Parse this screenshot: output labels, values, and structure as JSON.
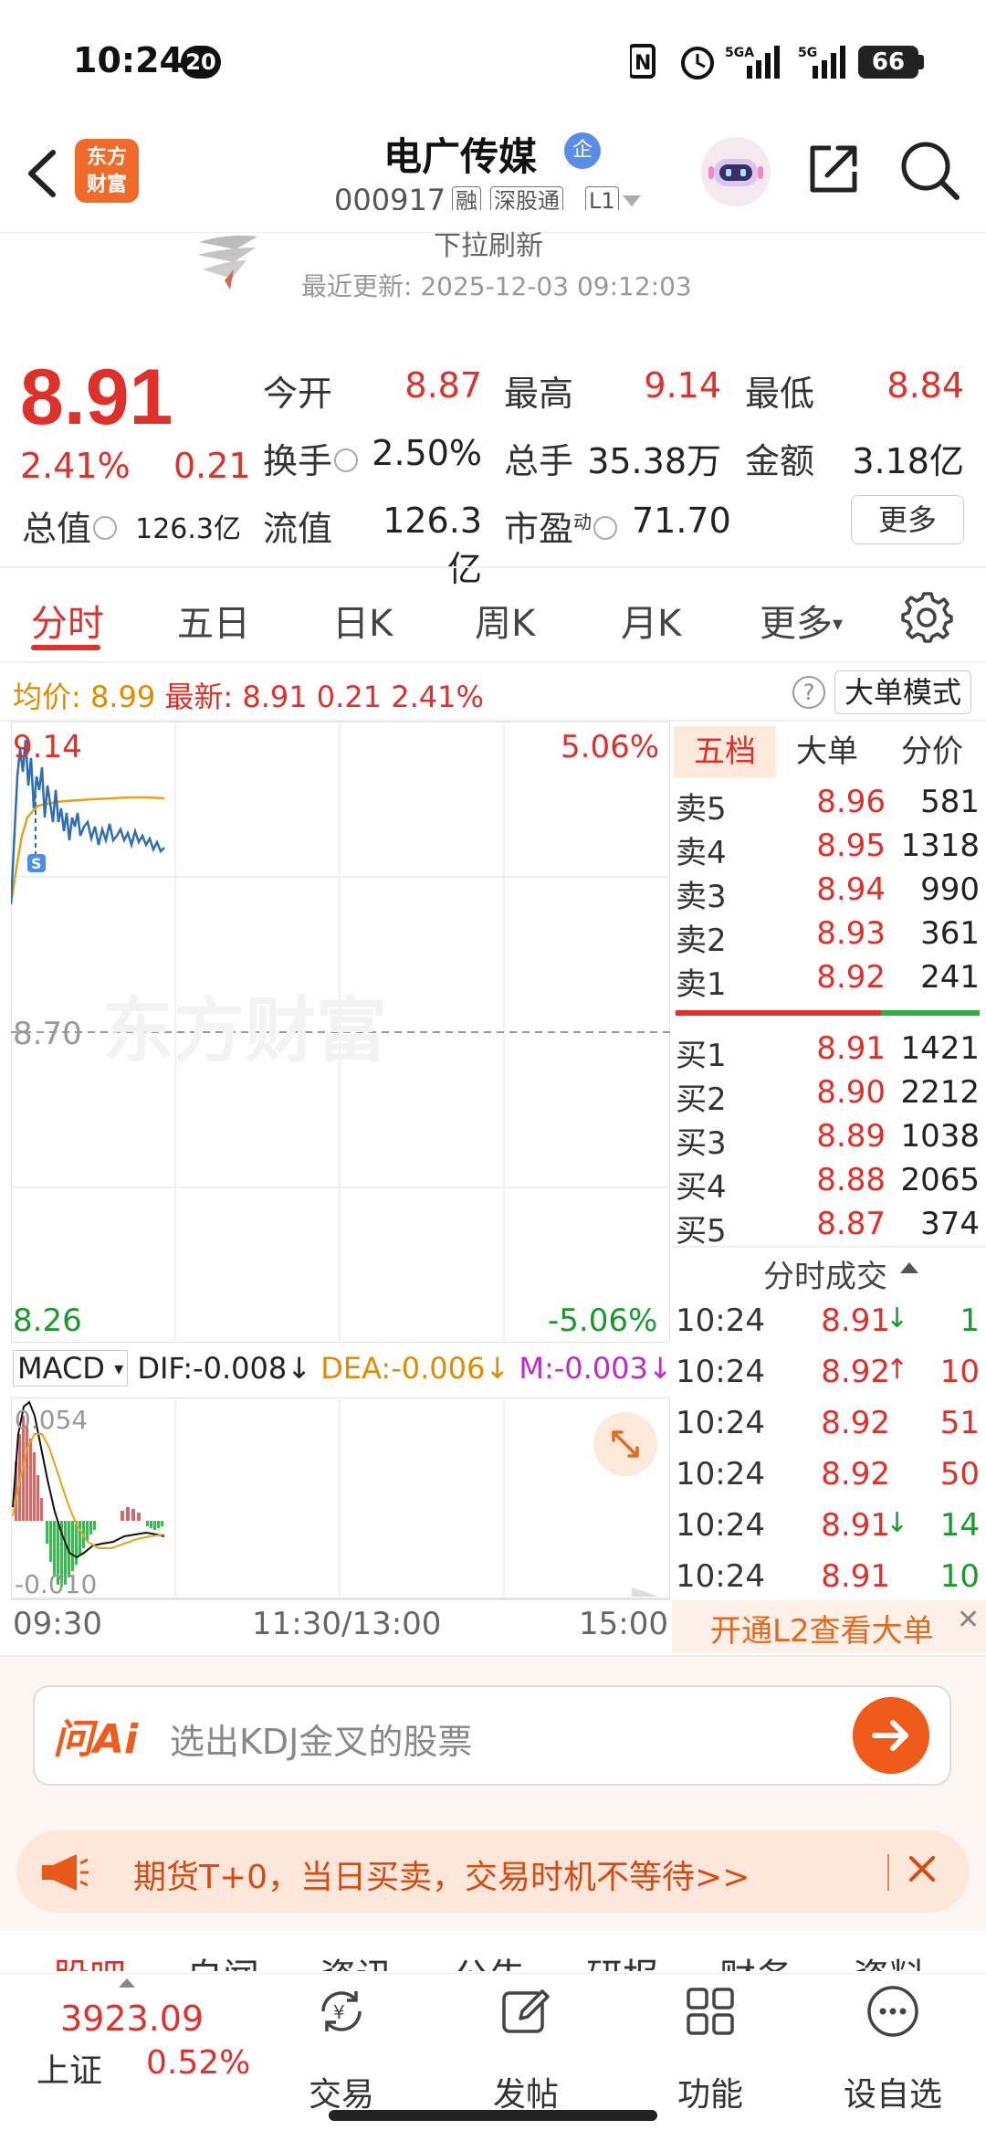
{
  "status_bar": {
    "time": "10:24",
    "notification_count": "20",
    "network_1": "5GA",
    "network_2": "5G",
    "battery": "66"
  },
  "header": {
    "logo_line1": "东方",
    "logo_line2": "财富",
    "stock_name": "电广传媒",
    "verified_badge": "企",
    "stock_code": "000917",
    "tags": [
      "融",
      "深股通",
      "L1"
    ]
  },
  "refresh": {
    "label": "下拉刷新",
    "last_update": "最近更新: 2025-12-03 09:12:03"
  },
  "quote": {
    "price": "8.91",
    "change_pct": "2.41%",
    "change": "0.21",
    "open_label": "今开",
    "open": "8.87",
    "high_label": "最高",
    "high": "9.14",
    "low_label": "最低",
    "low": "8.84",
    "turnover_label": "换手",
    "turnover": "2.50%",
    "volume_label": "总手",
    "volume": "35.38万",
    "amount_label": "金额",
    "amount": "3.18亿",
    "mktcap_label": "总值",
    "mktcap": "126.3亿",
    "float_label": "流值",
    "float": "126.3亿",
    "pe_label": "市盈",
    "pe_sup": "动",
    "pe": "71.70",
    "more_label": "更多"
  },
  "tabs": [
    "分时",
    "五日",
    "日K",
    "周K",
    "月K",
    "更多"
  ],
  "summary": {
    "avg_label": "均价:",
    "avg": "8.99",
    "latest_label": "最新:",
    "latest": "8.91",
    "latest_chg": "0.21",
    "latest_pct": "2.41%",
    "help": "?",
    "big_order_mode": "大单模式"
  },
  "chart": {
    "price_high": "9.14",
    "pct_high": "5.06%",
    "price_mid": "8.70",
    "price_low": "8.26",
    "pct_low": "-5.06%",
    "watermark": "东方财富",
    "marker": "S",
    "time_start": "09:30",
    "time_mid": "11:30/13:00",
    "time_end": "15:00",
    "colors": {
      "price_line": "#2f6db5",
      "avg_line": "#e8a21a"
    }
  },
  "macd": {
    "select": "MACD",
    "dif": "DIF:-0.008↓",
    "dea": "DEA:-0.006↓",
    "m": "M:-0.003↓",
    "top_label": "0.054",
    "bottom_label": "-0.010"
  },
  "order_book": {
    "tabs": [
      "五档",
      "大单",
      "分价"
    ],
    "asks": [
      {
        "label": "卖5",
        "price": "8.96",
        "vol": "581"
      },
      {
        "label": "卖4",
        "price": "8.95",
        "vol": "1318"
      },
      {
        "label": "卖3",
        "price": "8.94",
        "vol": "990"
      },
      {
        "label": "卖2",
        "price": "8.93",
        "vol": "361"
      },
      {
        "label": "卖1",
        "price": "8.92",
        "vol": "241"
      }
    ],
    "bids": [
      {
        "label": "买1",
        "price": "8.91",
        "vol": "1421"
      },
      {
        "label": "买2",
        "price": "8.90",
        "vol": "2212"
      },
      {
        "label": "买3",
        "price": "8.89",
        "vol": "1038"
      },
      {
        "label": "买4",
        "price": "8.88",
        "vol": "2065"
      },
      {
        "label": "买5",
        "price": "8.87",
        "vol": "374"
      }
    ]
  },
  "trades": {
    "title": "分时成交",
    "rows": [
      {
        "time": "10:24",
        "price": "8.91",
        "dir": "↓",
        "vol": "1",
        "color": "green"
      },
      {
        "time": "10:24",
        "price": "8.92",
        "dir": "↑",
        "vol": "10",
        "color": "red"
      },
      {
        "time": "10:24",
        "price": "8.92",
        "dir": "",
        "vol": "51",
        "color": "red"
      },
      {
        "time": "10:24",
        "price": "8.92",
        "dir": "",
        "vol": "50",
        "color": "red"
      },
      {
        "time": "10:24",
        "price": "8.91",
        "dir": "↓",
        "vol": "14",
        "color": "green"
      },
      {
        "time": "10:24",
        "price": "8.91",
        "dir": "",
        "vol": "10",
        "color": "green"
      }
    ],
    "l2_banner": "开通L2查看大单",
    "l2_close": "✕"
  },
  "ai_search": {
    "logo": "问Ai",
    "placeholder": "选出KDJ金叉的股票"
  },
  "ad": {
    "text": "期货T+0，当日买卖，交易时机不等待>>"
  },
  "section_tabs": [
    "股吧",
    "自闻",
    "资讯",
    "公告",
    "研报",
    "财务",
    "资料"
  ],
  "bottom_nav": {
    "index_value": "3923.09",
    "index_name": "上证",
    "index_pct": "0.52%",
    "items": [
      "交易",
      "发帖",
      "功能",
      "设自选"
    ]
  }
}
